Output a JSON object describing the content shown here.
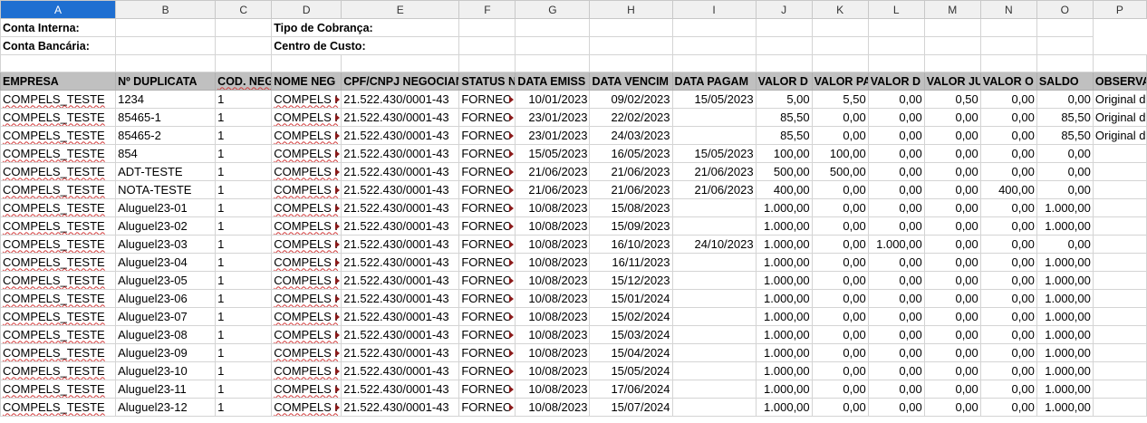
{
  "columns": [
    "A",
    "B",
    "C",
    "D",
    "E",
    "F",
    "G",
    "H",
    "I",
    "J",
    "K",
    "L",
    "M",
    "N",
    "O",
    "P"
  ],
  "active_column": "A",
  "meta": {
    "conta_interna": "Conta Interna:",
    "conta_bancaria": "Conta Bancária:",
    "tipo_cobranca": "Tipo de Cobrança:",
    "centro_custo": "Centro de Custo:"
  },
  "headers": [
    "EMPRESA",
    "Nº DUPLICATA",
    "COD. NEG",
    "NOME NEG",
    "CPF/CNPJ NEGOCIAN",
    "STATUS N",
    "DATA EMISS",
    "DATA VENCIM",
    "DATA PAGAM",
    "VALOR D",
    "VALOR PA",
    "VALOR D",
    "VALOR JU",
    "VALOR O",
    "SALDO",
    "OBSERVA"
  ],
  "rows": [
    [
      "COMPELS_TESTE",
      "1234",
      "1",
      "COMPELS I",
      "21.522.430/0001-43",
      "FORNEC",
      "10/01/2023",
      "09/02/2023",
      "15/05/2023",
      "5,00",
      "5,50",
      "0,00",
      "0,50",
      "0,00",
      "0,00",
      "Original do"
    ],
    [
      "COMPELS_TESTE",
      "85465-1",
      "1",
      "COMPELS I",
      "21.522.430/0001-43",
      "FORNEC",
      "23/01/2023",
      "22/02/2023",
      "",
      "85,50",
      "0,00",
      "0,00",
      "0,00",
      "0,00",
      "85,50",
      "Original da"
    ],
    [
      "COMPELS_TESTE",
      "85465-2",
      "1",
      "COMPELS I",
      "21.522.430/0001-43",
      "FORNEC",
      "23/01/2023",
      "24/03/2023",
      "",
      "85,50",
      "0,00",
      "0,00",
      "0,00",
      "0,00",
      "85,50",
      "Original da"
    ],
    [
      "COMPELS_TESTE",
      "854",
      "1",
      "COMPELS I",
      "21.522.430/0001-43",
      "FORNEC",
      "15/05/2023",
      "16/05/2023",
      "15/05/2023",
      "100,00",
      "100,00",
      "0,00",
      "0,00",
      "0,00",
      "0,00",
      ""
    ],
    [
      "COMPELS_TESTE",
      "ADT-TESTE",
      "1",
      "COMPELS I",
      "21.522.430/0001-43",
      "FORNEC",
      "21/06/2023",
      "21/06/2023",
      "21/06/2023",
      "500,00",
      "500,00",
      "0,00",
      "0,00",
      "0,00",
      "0,00",
      ""
    ],
    [
      "COMPELS_TESTE",
      "NOTA-TESTE",
      "1",
      "COMPELS I",
      "21.522.430/0001-43",
      "FORNEC",
      "21/06/2023",
      "21/06/2023",
      "21/06/2023",
      "400,00",
      "0,00",
      "0,00",
      "0,00",
      "400,00",
      "0,00",
      ""
    ],
    [
      "COMPELS_TESTE",
      "Aluguel23-01",
      "1",
      "COMPELS I",
      "21.522.430/0001-43",
      "FORNEC",
      "10/08/2023",
      "15/08/2023",
      "",
      "1.000,00",
      "0,00",
      "0,00",
      "0,00",
      "0,00",
      "1.000,00",
      ""
    ],
    [
      "COMPELS_TESTE",
      "Aluguel23-02",
      "1",
      "COMPELS I",
      "21.522.430/0001-43",
      "FORNEC",
      "10/08/2023",
      "15/09/2023",
      "",
      "1.000,00",
      "0,00",
      "0,00",
      "0,00",
      "0,00",
      "1.000,00",
      ""
    ],
    [
      "COMPELS_TESTE",
      "Aluguel23-03",
      "1",
      "COMPELS I",
      "21.522.430/0001-43",
      "FORNEC",
      "10/08/2023",
      "16/10/2023",
      "24/10/2023",
      "1.000,00",
      "0,00",
      "1.000,00",
      "0,00",
      "0,00",
      "0,00",
      ""
    ],
    [
      "COMPELS_TESTE",
      "Aluguel23-04",
      "1",
      "COMPELS I",
      "21.522.430/0001-43",
      "FORNEC",
      "10/08/2023",
      "16/11/2023",
      "",
      "1.000,00",
      "0,00",
      "0,00",
      "0,00",
      "0,00",
      "1.000,00",
      ""
    ],
    [
      "COMPELS_TESTE",
      "Aluguel23-05",
      "1",
      "COMPELS I",
      "21.522.430/0001-43",
      "FORNEC",
      "10/08/2023",
      "15/12/2023",
      "",
      "1.000,00",
      "0,00",
      "0,00",
      "0,00",
      "0,00",
      "1.000,00",
      ""
    ],
    [
      "COMPELS_TESTE",
      "Aluguel23-06",
      "1",
      "COMPELS I",
      "21.522.430/0001-43",
      "FORNEC",
      "10/08/2023",
      "15/01/2024",
      "",
      "1.000,00",
      "0,00",
      "0,00",
      "0,00",
      "0,00",
      "1.000,00",
      ""
    ],
    [
      "COMPELS_TESTE",
      "Aluguel23-07",
      "1",
      "COMPELS I",
      "21.522.430/0001-43",
      "FORNEC",
      "10/08/2023",
      "15/02/2024",
      "",
      "1.000,00",
      "0,00",
      "0,00",
      "0,00",
      "0,00",
      "1.000,00",
      ""
    ],
    [
      "COMPELS_TESTE",
      "Aluguel23-08",
      "1",
      "COMPELS I",
      "21.522.430/0001-43",
      "FORNEC",
      "10/08/2023",
      "15/03/2024",
      "",
      "1.000,00",
      "0,00",
      "0,00",
      "0,00",
      "0,00",
      "1.000,00",
      ""
    ],
    [
      "COMPELS_TESTE",
      "Aluguel23-09",
      "1",
      "COMPELS I",
      "21.522.430/0001-43",
      "FORNEC",
      "10/08/2023",
      "15/04/2024",
      "",
      "1.000,00",
      "0,00",
      "0,00",
      "0,00",
      "0,00",
      "1.000,00",
      ""
    ],
    [
      "COMPELS_TESTE",
      "Aluguel23-10",
      "1",
      "COMPELS I",
      "21.522.430/0001-43",
      "FORNEC",
      "10/08/2023",
      "15/05/2024",
      "",
      "1.000,00",
      "0,00",
      "0,00",
      "0,00",
      "0,00",
      "1.000,00",
      ""
    ],
    [
      "COMPELS_TESTE",
      "Aluguel23-11",
      "1",
      "COMPELS I",
      "21.522.430/0001-43",
      "FORNEC",
      "10/08/2023",
      "17/06/2024",
      "",
      "1.000,00",
      "0,00",
      "0,00",
      "0,00",
      "0,00",
      "1.000,00",
      ""
    ],
    [
      "COMPELS_TESTE",
      "Aluguel23-12",
      "1",
      "COMPELS I",
      "21.522.430/0001-43",
      "FORNEC",
      "10/08/2023",
      "15/07/2024",
      "",
      "1.000,00",
      "0,00",
      "0,00",
      "0,00",
      "0,00",
      "1.000,00",
      ""
    ]
  ],
  "colors": {
    "header_fill": "#c0c0c0",
    "active_col": "#1f6fd1",
    "gridline": "#d4d4d4"
  }
}
